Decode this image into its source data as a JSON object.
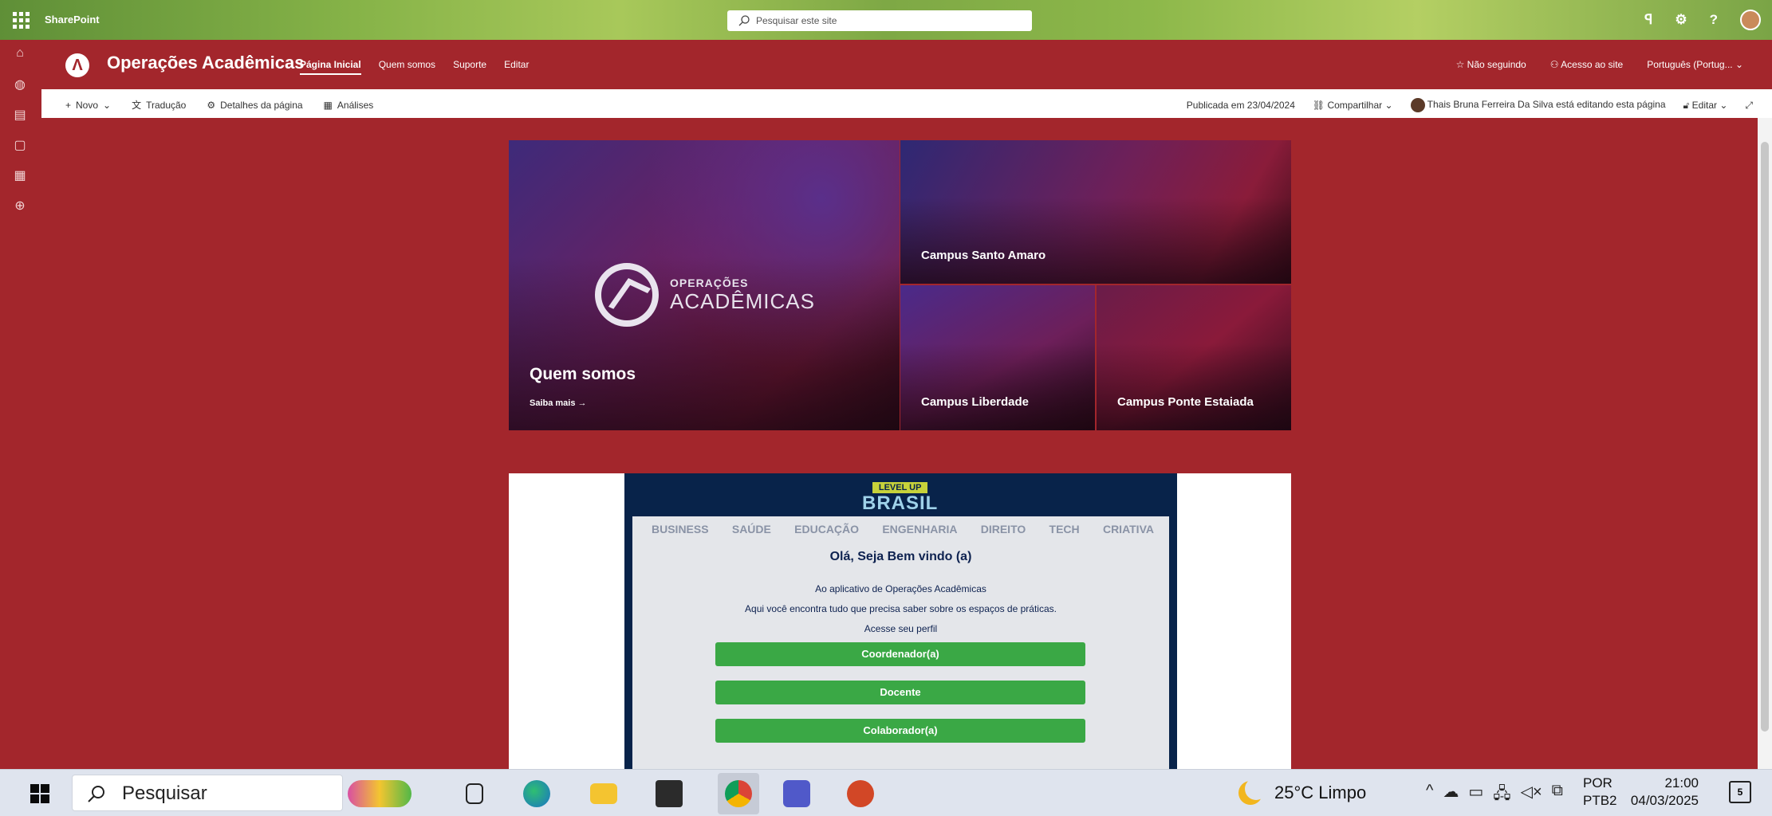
{
  "suite": {
    "brand": "SharePoint",
    "search_placeholder": "Pesquisar este site"
  },
  "site": {
    "title": "Operações Acadêmicas",
    "nav": [
      "Página Inicial",
      "Quem somos",
      "Suporte",
      "Editar"
    ],
    "follow": "Não seguindo",
    "access": "Acesso ao site",
    "language": "Português (Portug..."
  },
  "cmdbar": {
    "new": "Novo",
    "translate": "Tradução",
    "details": "Detalhes da página",
    "analytics": "Análises",
    "published": "Publicada em 23/04/2024",
    "share": "Compartilhar",
    "editing": "Thais Bruna Ferreira Da Silva está editando esta página",
    "edit": "Editar"
  },
  "hero": {
    "main_title": "Quem somos",
    "main_link": "Saiba mais",
    "logo_word1": "OPERAÇÕES",
    "logo_word2": "ACADÊMICAS",
    "tiles": [
      "Campus Santo Amaro",
      "Campus Liberdade",
      "Campus Ponte Estaiada"
    ]
  },
  "app": {
    "level_top": "LEVEL UP",
    "level_bottom": "BRASIL",
    "brands": [
      "BUSINESS",
      "SAÚDE",
      "EDUCAÇÃO",
      "ENGENHARIA",
      "DIREITO",
      "TECH",
      "CRIATIVA"
    ],
    "welcome": "Olá, Seja Bem vindo (a)",
    "line1": "Ao aplicativo de Operações Acadêmicas",
    "line2": "Aqui você encontra tudo que precisa saber sobre os espaços de práticas.",
    "line3": "Acesse seu perfil",
    "buttons": [
      "Coordenador(a)",
      "Docente",
      "Colaborador(a)"
    ]
  },
  "taskbar": {
    "search": "Pesquisar",
    "weather": "25°C  Limpo",
    "lang1": "POR",
    "lang2": "PTB2",
    "time": "21:00",
    "date": "04/03/2025",
    "notifications": "5"
  }
}
